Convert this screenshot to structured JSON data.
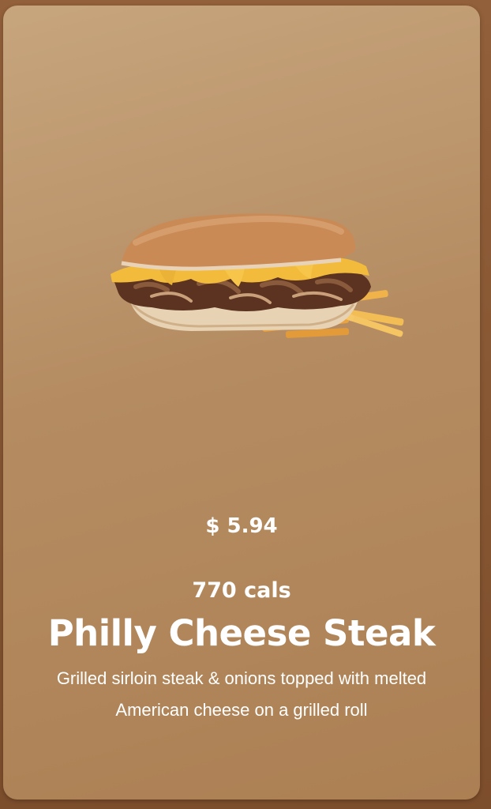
{
  "product": {
    "image_icon": "philly-cheese-steak-sandwich-image",
    "price": "$ 5.94",
    "calories": "770 cals",
    "name": "Philly Cheese Steak",
    "description": "Grilled sirloin steak & onions topped with melted American cheese on a grilled roll"
  },
  "colors": {
    "card_top": "#c7a57d",
    "card_bottom": "#ac8053",
    "frame": "#8a5a34",
    "text": "#ffffff"
  }
}
